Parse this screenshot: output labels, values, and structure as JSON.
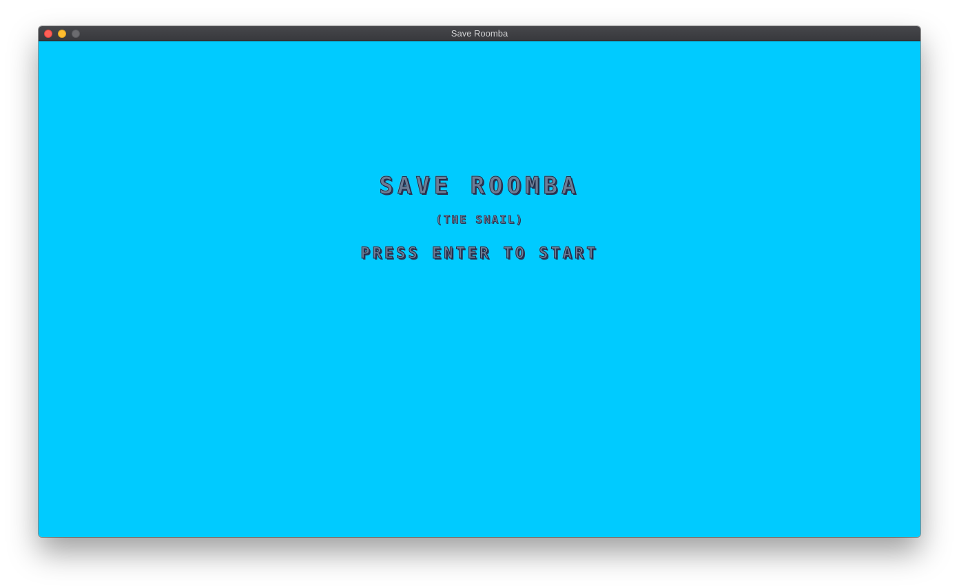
{
  "window": {
    "title": "Save Roomba"
  },
  "game": {
    "background_color": "#00cbff",
    "title": "SAVE ROOMBA",
    "subtitle": "(THE SNAIL)",
    "prompt": "PRESS ENTER TO START"
  }
}
